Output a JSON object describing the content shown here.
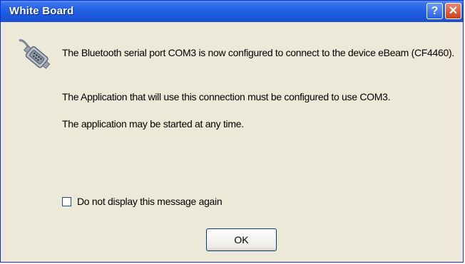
{
  "window": {
    "title": "White Board",
    "help_label": "?",
    "close_label": "✕"
  },
  "message": {
    "line1": "The Bluetooth serial port COM3 is now configured to connect to the device eBeam (CF4460).",
    "line2": "The Application that will use this connection must be configured to use COM3.",
    "line3": "The application may be started at any time."
  },
  "checkbox": {
    "label": "Do not display this message again",
    "checked": false
  },
  "buttons": {
    "ok_label": "OK"
  },
  "icons": {
    "message_icon": "serial-connector-icon"
  },
  "colors": {
    "titlebar": "#245edb",
    "dialog_bg": "#ece9d8",
    "close_button": "#c6421c"
  }
}
